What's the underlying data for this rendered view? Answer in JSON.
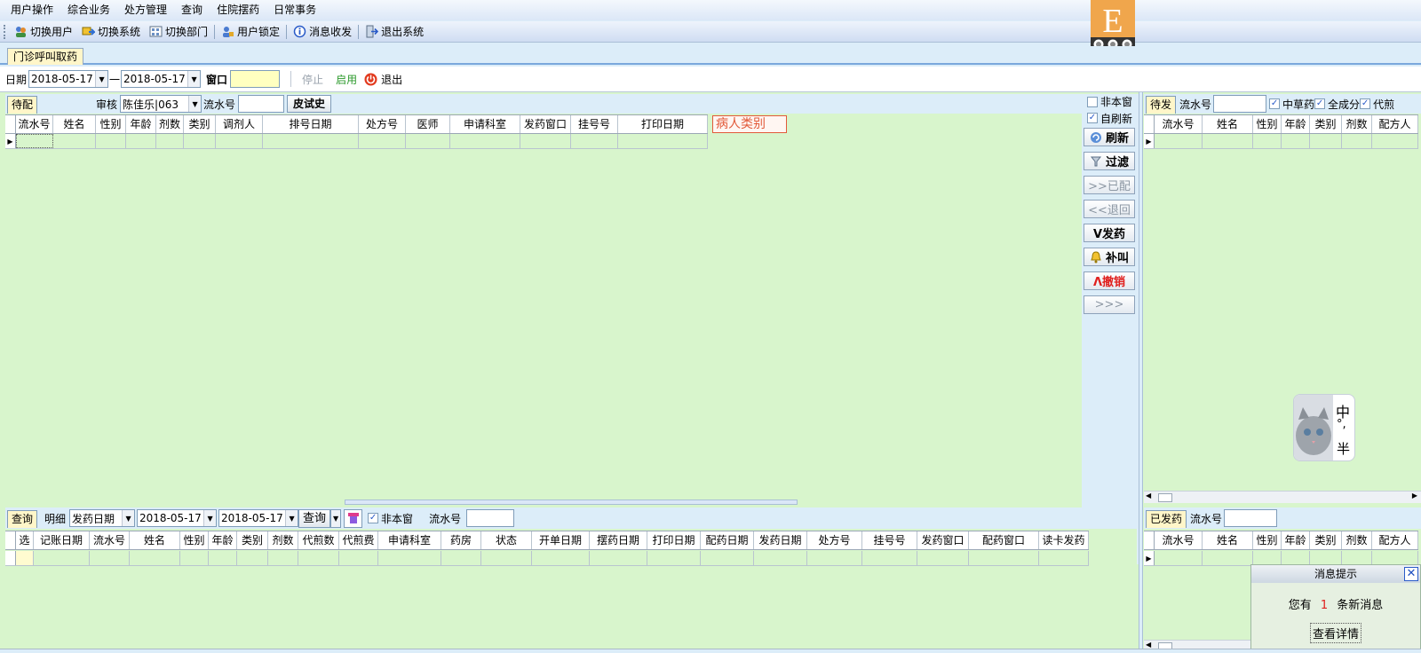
{
  "menu": [
    "用户操作",
    "综合业务",
    "处方管理",
    "查询",
    "住院摆药",
    "日常事务"
  ],
  "toolbar": [
    {
      "label": "切换用户",
      "icon": "users-icon"
    },
    {
      "label": "切换系统",
      "icon": "switch-system-icon"
    },
    {
      "label": "切换部门",
      "icon": "department-icon"
    },
    {
      "label": "用户锁定",
      "icon": "user-lock-icon"
    },
    {
      "label": "消息收发",
      "icon": "message-icon"
    },
    {
      "label": "退出系统",
      "icon": "exit-icon"
    }
  ],
  "logo": {
    "letter": "E"
  },
  "doc_tab": "门诊呼叫取药",
  "filter": {
    "date_label": "日期",
    "date_from": "2018-05-17",
    "dash": "一",
    "date_to": "2018-05-17",
    "window_label": "窗口",
    "stop": "停止",
    "enable": "启用",
    "exit": "退出"
  },
  "pending": {
    "tab": "待配",
    "reviewer_label": "审核",
    "reviewer_value": "陈佳乐|063",
    "serial_label": "流水号",
    "skin_test_button": "皮试史",
    "columns": [
      "流水号",
      "姓名",
      "性别",
      "年龄",
      "剂数",
      "类别",
      "调剂人",
      "排号日期",
      "处方号",
      "医师",
      "申请科室",
      "发药窗口",
      "挂号号",
      "打印日期"
    ],
    "patient_type_label": "病人类别"
  },
  "side": {
    "non_window": "非本窗",
    "auto_refresh": "自刷新",
    "buttons": [
      "刷新",
      "过滤",
      ">>已配",
      "<<退回",
      "V发药",
      "补叫",
      "Λ撤销",
      ">>>"
    ]
  },
  "query": {
    "tab": "查询",
    "detail": "明细",
    "date_type": "发药日期",
    "date_from": "2018-05-17",
    "date_to": "2018-05-17",
    "query_button": "查询",
    "non_window": "非本窗",
    "serial_label": "流水号",
    "columns": [
      "选",
      "记账日期",
      "流水号",
      "姓名",
      "性别",
      "年龄",
      "类别",
      "剂数",
      "代煎数",
      "代煎费",
      "申请科室",
      "药房",
      "状态",
      "开单日期",
      "摆药日期",
      "打印日期",
      "配药日期",
      "发药日期",
      "处方号",
      "挂号号",
      "发药窗口",
      "配药窗口",
      "读卡发药"
    ]
  },
  "to_dispense": {
    "tab": "待发",
    "serial_label": "流水号",
    "chk1": "中草药",
    "chk2": "全成分",
    "chk3": "代煎",
    "columns": [
      "流水号",
      "姓名",
      "性别",
      "年龄",
      "类别",
      "剂数",
      "配方人"
    ]
  },
  "dispensed": {
    "tab": "已发药",
    "serial_label": "流水号",
    "columns": [
      "流水号",
      "姓名",
      "性别",
      "年龄",
      "类别",
      "剂数",
      "配方人"
    ]
  },
  "ime": {
    "text1": "中",
    "text2": "°,",
    "text3": "半"
  },
  "message": {
    "title": "消息提示",
    "prefix": "您有",
    "count": "1",
    "suffix": "条新消息",
    "details_button": "查看详情"
  }
}
